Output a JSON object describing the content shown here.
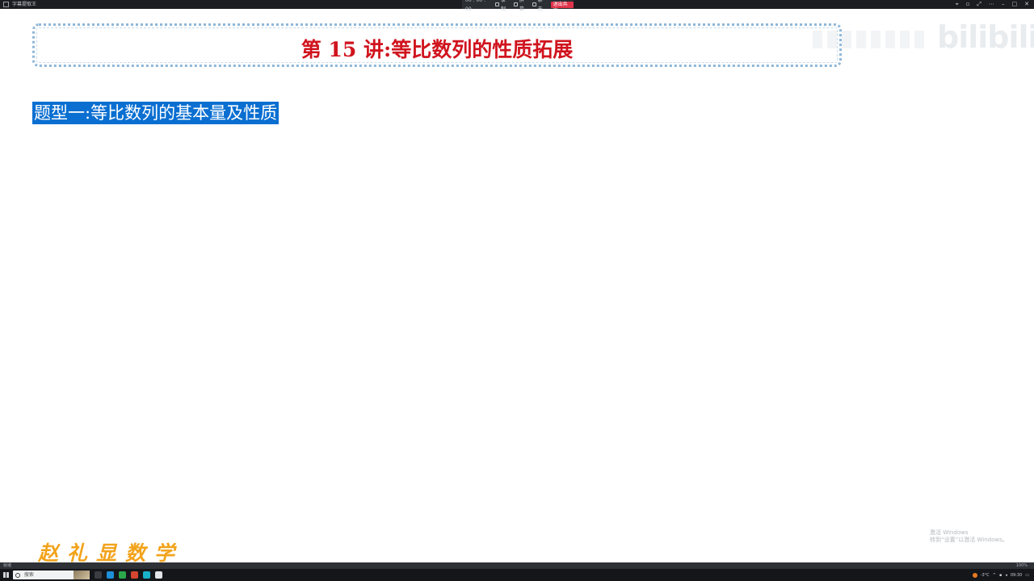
{
  "window": {
    "app_title": "字幕提取王",
    "meeting_timer": "00 : 00 : 00",
    "meeting_items": [
      "录制",
      "屏幕",
      "聊天"
    ],
    "end_label": "退出共享"
  },
  "slide": {
    "title": "第 15 讲:等比数列的性质拓展",
    "section_heading": "题型一:等比数列的基本量及性质",
    "watermark": "bilibili",
    "brand": "赵礼显数学"
  },
  "system": {
    "activate_line1": "激活 Windows",
    "activate_line2": "转到“设置”以激活 Windows。",
    "status_left": "就绪",
    "status_right": "100%",
    "search_placeholder": "搜索",
    "temperature": "-3°C",
    "clock": "09:30"
  },
  "colors": {
    "title_red": "#d0141e",
    "highlight_blue": "#0a6fd1",
    "brand_orange": "#f2a31b",
    "frame_blue": "#8fb7d8"
  }
}
